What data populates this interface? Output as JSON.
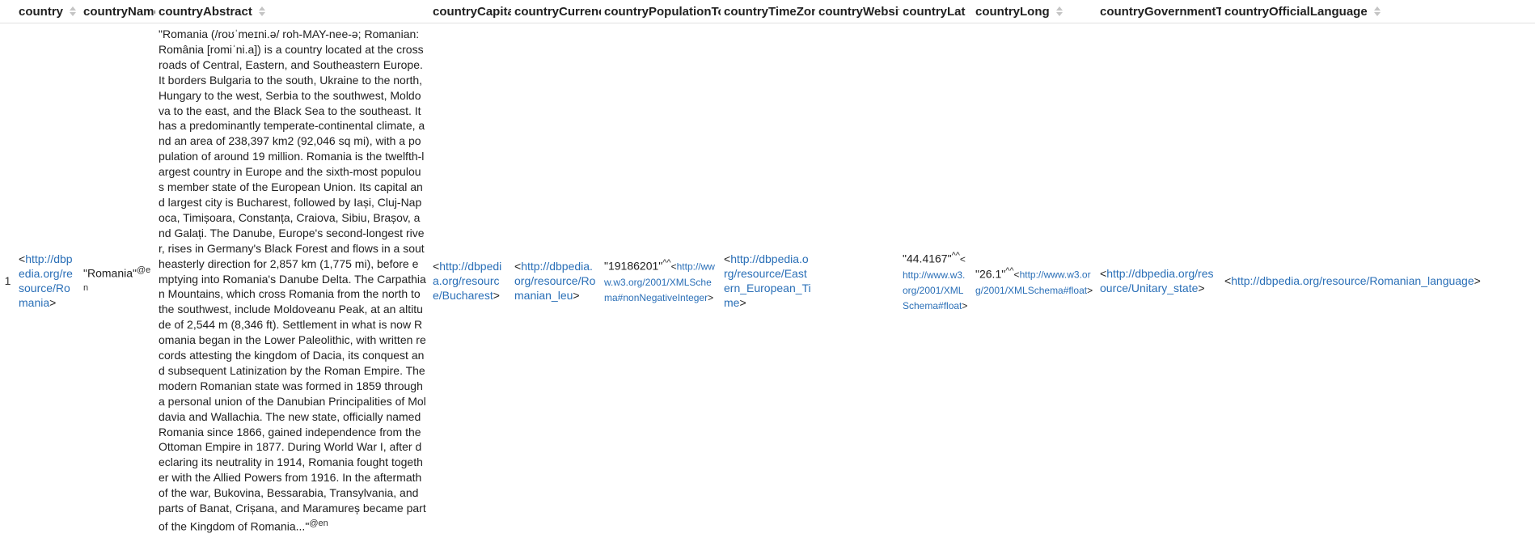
{
  "columns": [
    "country",
    "countryName",
    "countryAbstract",
    "countryCapital",
    "countryCurrency",
    "countryPopulationTotal",
    "countryTimeZone",
    "countryWebsite",
    "countryLat",
    "countryLong",
    "countryGovernmentType",
    "countryOfficialLanguage"
  ],
  "row": {
    "index": "1",
    "country": "http://dbpedia.org/resource/Romania",
    "countryName": {
      "value": "Romania",
      "lang": "@en"
    },
    "countryAbstract": {
      "value": "Romania (/roʊˈmeɪni.ə/ roh-MAY-nee-ə; Romanian: România [romiˈni.a]) is a country located at the crossroads of Central, Eastern, and Southeastern Europe. It borders Bulgaria to the south, Ukraine to the north, Hungary to the west, Serbia to the southwest, Moldova to the east, and the Black Sea to the southeast. It has a predominantly temperate-continental climate, and an area of 238,397 km2 (92,046 sq mi), with a population of around 19 million. Romania is the twelfth-largest country in Europe and the sixth-most populous member state of the European Union. Its capital and largest city is Bucharest, followed by Iași, Cluj-Napoca, Timișoara, Constanța, Craiova, Sibiu, Brașov, and Galați. The Danube, Europe's second-longest river, rises in Germany's Black Forest and flows in a southeasterly direction for 2,857 km (1,775 mi), before emptying into Romania's Danube Delta. The Carpathian Mountains, which cross Romania from the north to the southwest, include Moldoveanu Peak, at an altitude of 2,544 m (8,346 ft). Settlement in what is now Romania began in the Lower Paleolithic, with written records attesting the kingdom of Dacia, its conquest and subsequent Latinization by the Roman Empire. The modern Romanian state was formed in 1859 through a personal union of the Danubian Principalities of Moldavia and Wallachia. The new state, officially named Romania since 1866, gained independence from the Ottoman Empire in 1877. During World War I, after declaring its neutrality in 1914, Romania fought together with the Allied Powers from 1916. In the aftermath of the war, Bukovina, Bessarabia, Transylvania, and parts of Banat, Crișana, and Maramureș became part of the Kingdom of Romania...",
      "lang": "@en"
    },
    "countryCapital": "http://dbpedia.org/resource/Bucharest",
    "countryCurrency": "http://dbpedia.org/resource/Romanian_leu",
    "countryPopulationTotal": {
      "value": "19186201",
      "datatype": "http://www.w3.org/2001/XMLSchema#nonNegativeInteger"
    },
    "countryTimeZone": "http://dbpedia.org/resource/Eastern_European_Time",
    "countryWebsite": "",
    "countryLat": {
      "value": "44.4167",
      "datatype": "http://www.w3.org/2001/XMLSchema#float"
    },
    "countryLong": {
      "value": "26.1",
      "datatype": "http://www.w3.org/2001/XMLSchema#float"
    },
    "countryGovernmentType": "http://dbpedia.org/resource/Unitary_state",
    "countryOfficialLanguage": "http://dbpedia.org/resource/Romanian_language"
  },
  "symbols": {
    "lt": "<",
    "gt": ">",
    "quote": "\"",
    "caret": "^^"
  },
  "icons": {
    "sort": "sort-arrows-icon"
  },
  "colors": {
    "link": "#2a6fb7",
    "header_text": "#212121",
    "sort_icon": "#c4c4c4"
  }
}
